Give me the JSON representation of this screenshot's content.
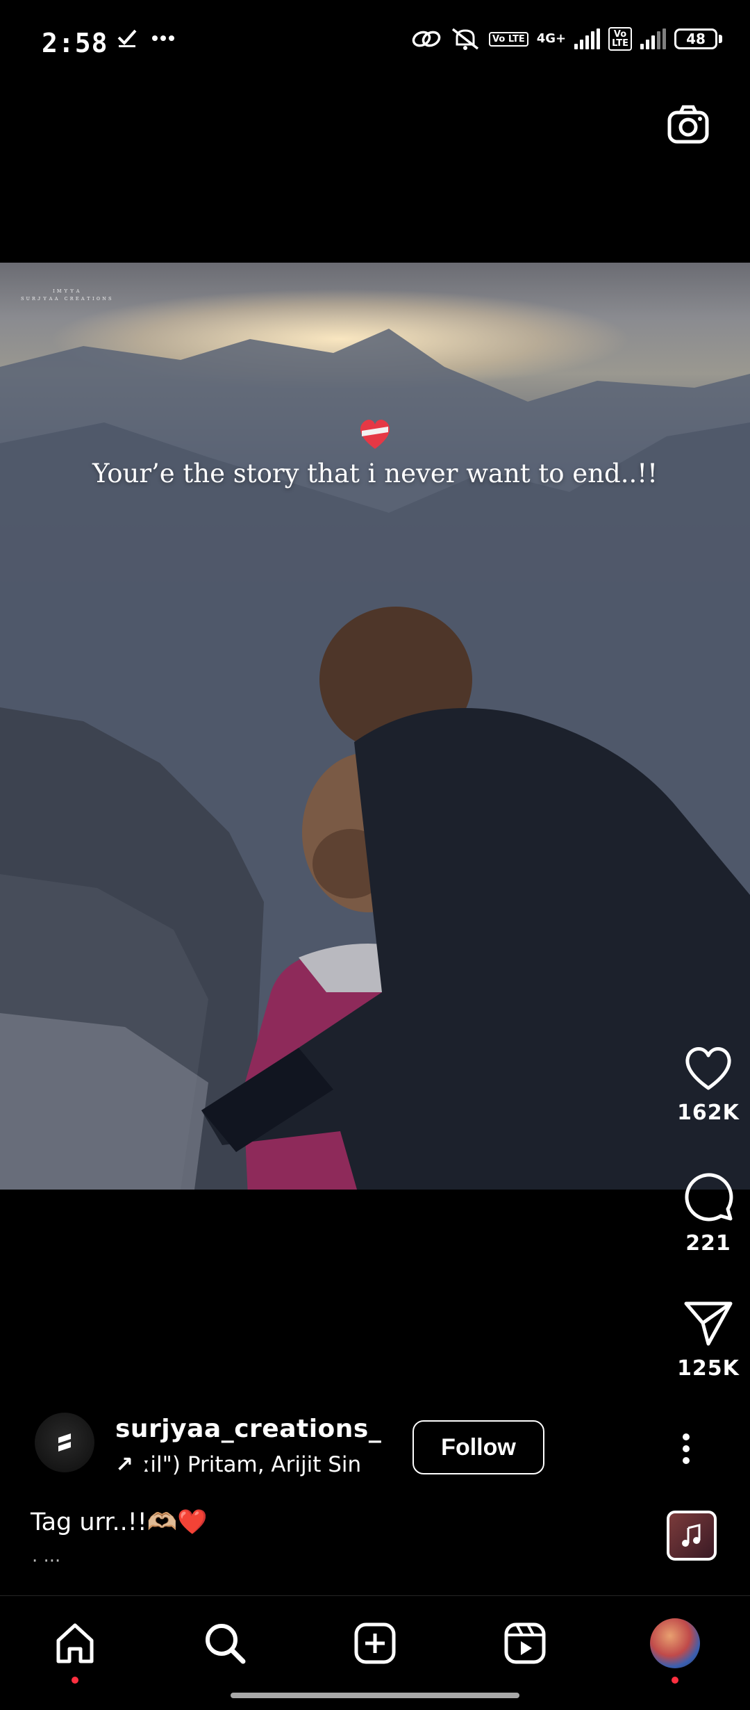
{
  "status_bar": {
    "time": "2:58",
    "battery": "48",
    "network": "4G+",
    "volte_label": "Vo LTE"
  },
  "video": {
    "watermark_line1": "ɪᴍʏʏᴀ",
    "watermark_line2": "ꜱᴜʀᴊʏᴀᴀ ᴄʀᴇᴀᴛɪᴏɴꜱ",
    "quote": "Your’e the story that i never want to end..!!"
  },
  "actions": {
    "likes": "162K",
    "comments": "221",
    "shares": "125K"
  },
  "post": {
    "username": "surjyaa_creations_",
    "music_arrow": "↗",
    "music_text": "ːil\")   Pritam, Arijit Sin",
    "follow_label": "Follow",
    "caption": "Tag urr..!!🫶🏼❤️",
    "caption_more": "· ···"
  },
  "colors": {
    "notification_dot": "#ff3040",
    "background": "#000000"
  }
}
